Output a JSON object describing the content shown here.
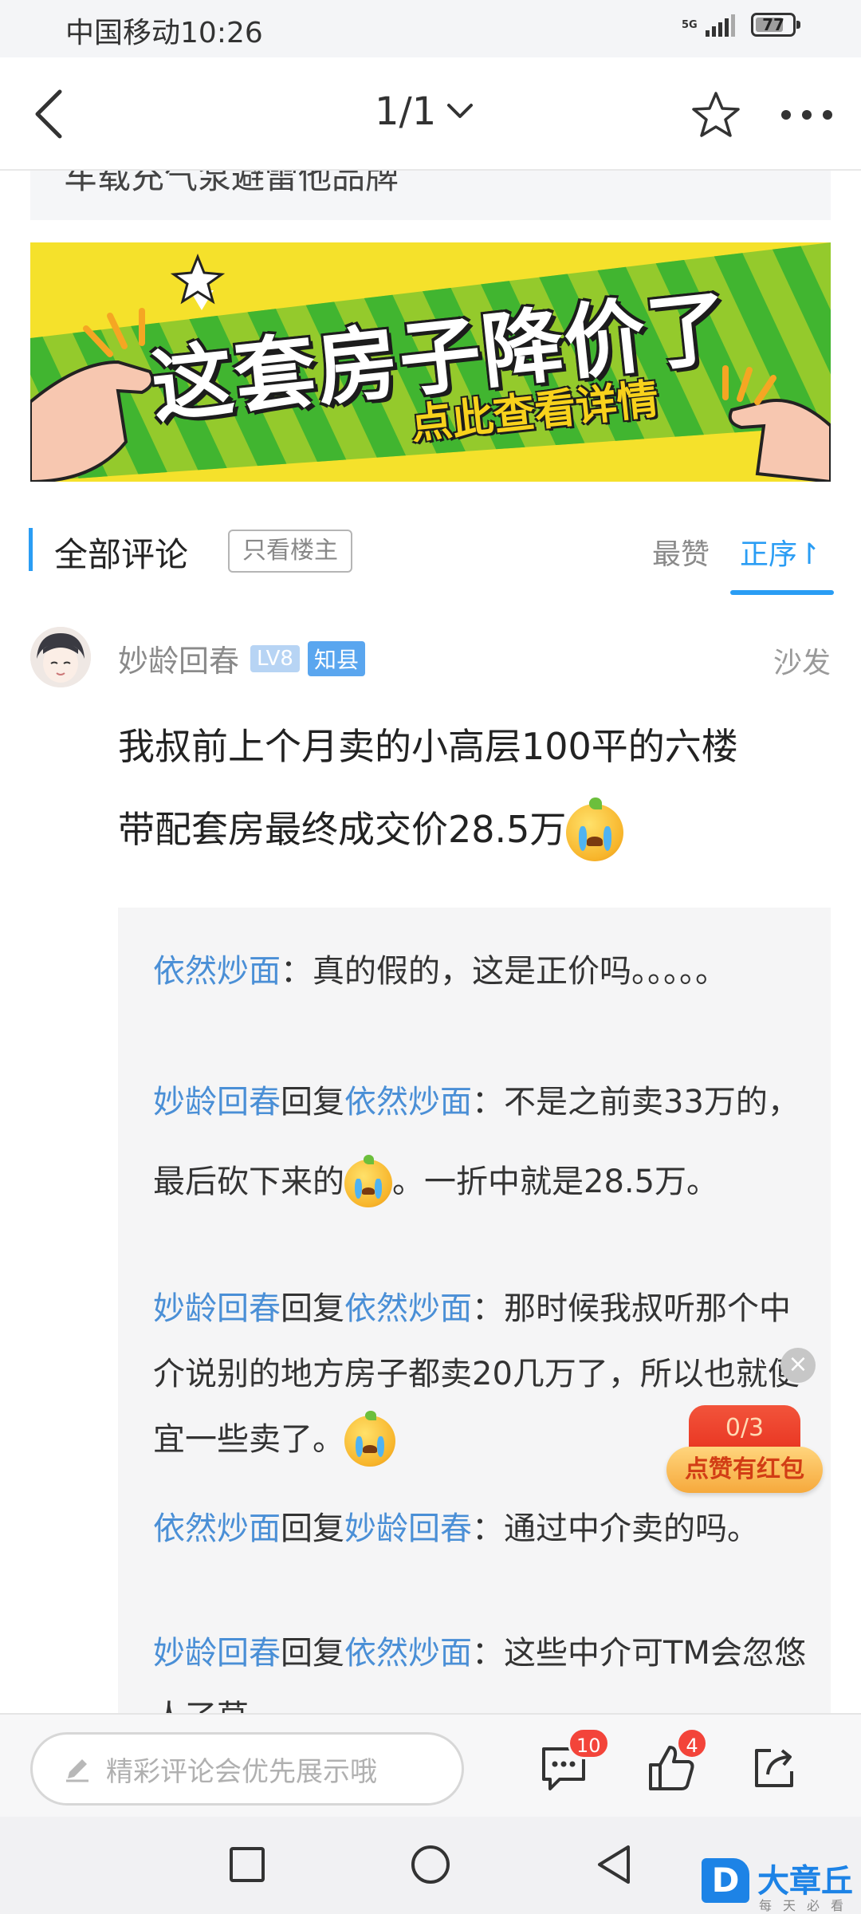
{
  "status_bar": {
    "carrier": "中国移动",
    "time": "10:26",
    "network": "5G",
    "battery": "77",
    "battery_level": 0.77
  },
  "nav": {
    "page_indicator": "1/1",
    "icons": [
      "back-icon",
      "chevron-down-icon",
      "star-icon",
      "more-icon"
    ]
  },
  "prev_card": {
    "text": "车载充气泵避雷他品牌"
  },
  "banner": {
    "title": "这套房子降价了",
    "subtitle": "点此查看详情",
    "colors": {
      "background": "#f5e12b",
      "stripe": "#3fb233"
    }
  },
  "comments_header": {
    "title": "全部评论",
    "op_only": "只看楼主",
    "sort_hot": "最赞",
    "sort_order": "正序↾"
  },
  "comment": {
    "username": "妙龄回春",
    "level": "LV8",
    "title_badge": "知县",
    "floor": "沙发",
    "body_line1": "我叔前上个月卖的小高层100平的六楼",
    "body_line2": "带配套房最终成交价28.5万"
  },
  "replies": [
    {
      "from": "依然炒面",
      "verb": "",
      "to": "",
      "sep": "：",
      "text": "真的假的，这是正价吗。。。。。",
      "text_after": ""
    },
    {
      "from": "妙龄回春",
      "verb": "回复",
      "to": "依然炒面",
      "sep": "：",
      "text": "不是之前卖33万的，最后砍下来的",
      "text_after": "。一折中就是28.5万。"
    },
    {
      "from": "妙龄回春",
      "verb": "回复",
      "to": "依然炒面",
      "sep": "：",
      "text": "那时候我叔听那个中介说别的地方房子都卖20几万了，所以也就便宜一些卖了。",
      "text_after": ""
    },
    {
      "from": "依然炒面",
      "verb": "回复",
      "to": "妙龄回春",
      "sep": "：",
      "text": "通过中介卖的吗。",
      "text_after": ""
    },
    {
      "from": "妙龄回春",
      "verb": "回复",
      "to": "依然炒面",
      "sep": "：",
      "text": "这些中介可TM会忽悠人了草",
      "text_after": ""
    }
  ],
  "float_widget": {
    "progress": "0/3",
    "label": "点赞有红包",
    "close": "×"
  },
  "action_bar": {
    "placeholder": "精彩评论会优先展示哦",
    "comment_count": "10",
    "like_count": "4"
  },
  "watermark": {
    "logo": "D",
    "name": "大章丘",
    "slogan": "每天必看"
  }
}
